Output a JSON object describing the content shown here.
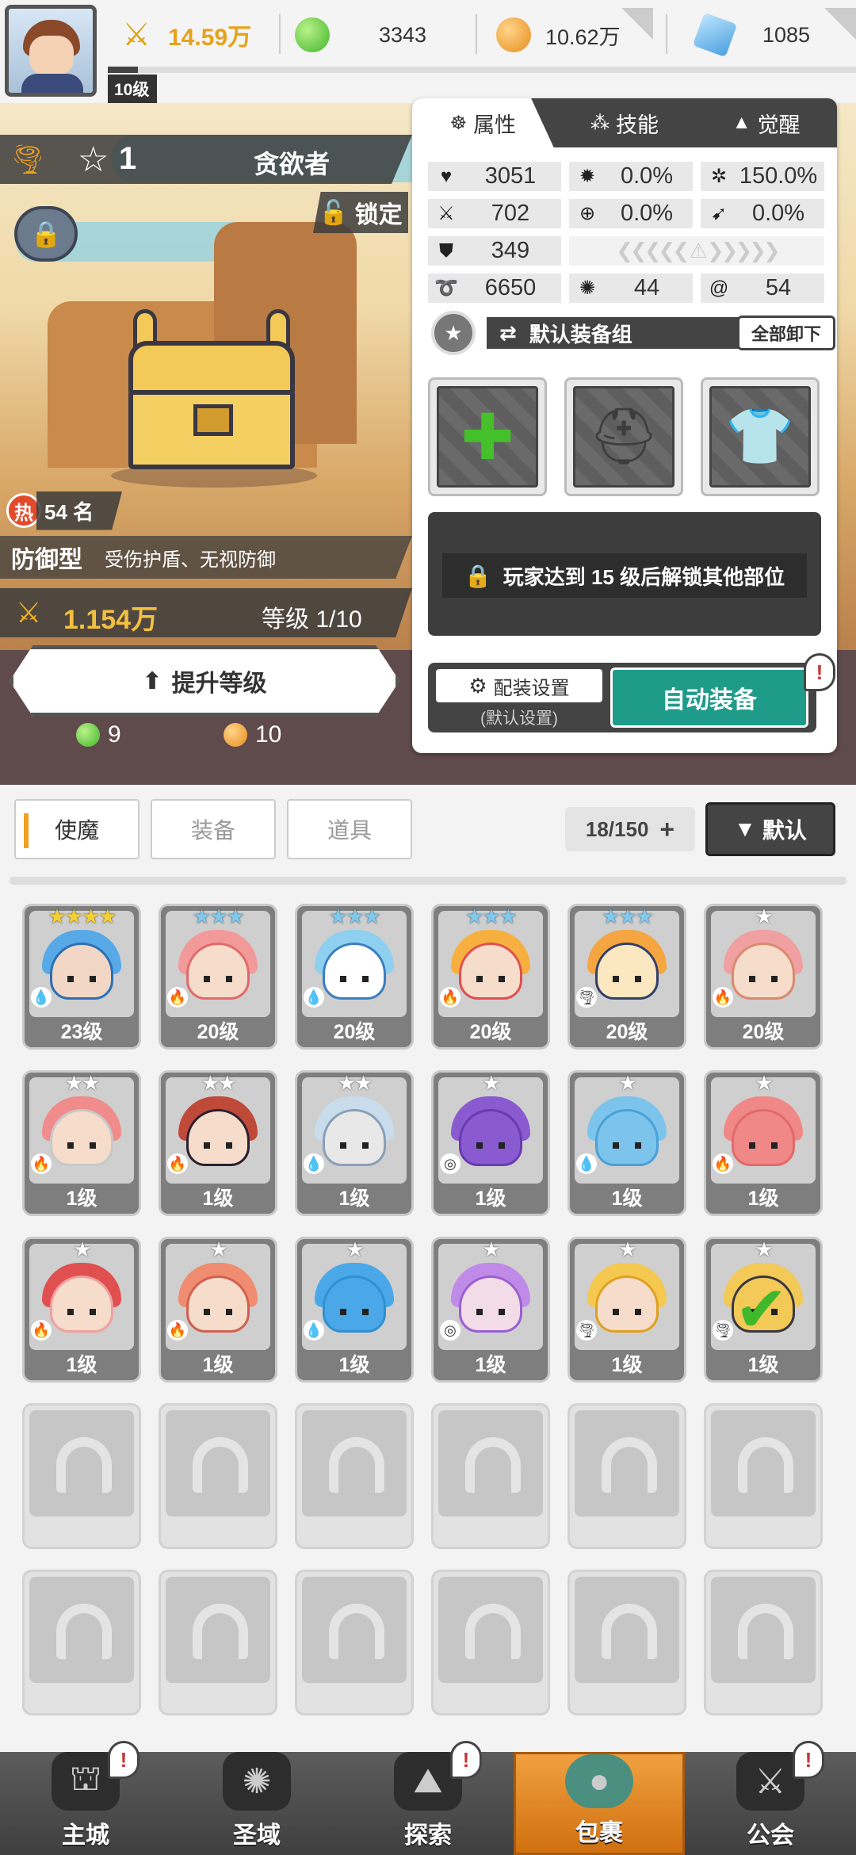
{
  "top_bar": {
    "power": "14.59万",
    "green_currency": "3343",
    "gold_currency": "10.62万",
    "gems": "1085",
    "level": "10级",
    "xp_fraction": 0.04
  },
  "hero": {
    "star_count": "1",
    "name": "贪欲者",
    "lock_label": "锁定",
    "rank": "54 名",
    "rank_badge": "热",
    "type": "防御型",
    "description": "受伤护盾、无视防御",
    "power": "1.154万",
    "level_text": "等级 1/10",
    "upgrade_label": "提升等级",
    "cost_green": "9",
    "cost_gold": "10"
  },
  "panel": {
    "tabs": [
      {
        "label": "属性",
        "icon": "mask-icon",
        "active": true
      },
      {
        "label": "技能",
        "icon": "sparkle-icon",
        "active": false
      },
      {
        "label": "觉醒",
        "icon": "triforce-icon",
        "active": false
      }
    ],
    "stats": {
      "hp": "3051",
      "crit": "0.0%",
      "crit_damage": "150.0%",
      "attack": "702",
      "accuracy": "0.0%",
      "dodge": "0.0%",
      "defense": "349",
      "speed": "6650",
      "stat_a": "44",
      "stat_b": "54"
    },
    "equip_group": "默认装备组",
    "unequip_all": "全部卸下",
    "locked_message": "玩家达到 15 级后解锁其他部位",
    "config_label": "配装设置",
    "config_sub": "(默认设置)",
    "auto_equip": "自动装备"
  },
  "inventory": {
    "tabs": [
      "使魔",
      "装备",
      "道具"
    ],
    "active_tab": "使魔",
    "count": "18/150",
    "sort_label": "默认",
    "cards": [
      {
        "level": "23级",
        "stars": "★★★★",
        "star_color": "#f5d030",
        "element": "water",
        "palette": [
          "#58a9e8",
          "#2e6fb4",
          "#f2d7c6"
        ]
      },
      {
        "level": "20级",
        "stars": "★★★",
        "star_color": "#7fc9ef",
        "element": "fire",
        "palette": [
          "#f29a9a",
          "#e06a6a",
          "#f6dccb"
        ]
      },
      {
        "level": "20级",
        "stars": "★★★",
        "star_color": "#7fc9ef",
        "element": "water",
        "palette": [
          "#8fd0f0",
          "#3a7fc0",
          "#ffffff"
        ]
      },
      {
        "level": "20级",
        "stars": "★★★",
        "star_color": "#7fc9ef",
        "element": "fire",
        "palette": [
          "#f7b040",
          "#e05050",
          "#f6dccb"
        ]
      },
      {
        "level": "20级",
        "stars": "★★★",
        "star_color": "#7fc9ef",
        "element": "wind",
        "palette": [
          "#f5a640",
          "#33406a",
          "#fbe7c0"
        ]
      },
      {
        "level": "20级",
        "stars": "★",
        "star_color": "#ffffff",
        "element": "fire",
        "palette": [
          "#f0a0a0",
          "#d88a70",
          "#f6dccb"
        ]
      },
      {
        "level": "1级",
        "stars": "★★",
        "star_color": "#ffffff",
        "element": "fire",
        "palette": [
          "#f08c8c",
          "#c8c8c8",
          "#f6dccb"
        ]
      },
      {
        "level": "1级",
        "stars": "★★",
        "star_color": "#ffffff",
        "element": "fire",
        "palette": [
          "#c04a3a",
          "#2c2030",
          "#f6dccb"
        ]
      },
      {
        "level": "1级",
        "stars": "★★",
        "star_color": "#ffffff",
        "element": "water",
        "palette": [
          "#c8dcec",
          "#8aa0b8",
          "#e8e8e8"
        ]
      },
      {
        "level": "1级",
        "stars": "★",
        "star_color": "#ffffff",
        "element": "arcane",
        "palette": [
          "#8a5ad0",
          "#6a3ab0",
          "#8a5ad0"
        ]
      },
      {
        "level": "1级",
        "stars": "★",
        "star_color": "#ffffff",
        "element": "water",
        "palette": [
          "#7cc4ec",
          "#4aa0d8",
          "#7cc4ec"
        ]
      },
      {
        "level": "1级",
        "stars": "★",
        "star_color": "#ffffff",
        "element": "fire",
        "palette": [
          "#f08888",
          "#e06a6a",
          "#f08888"
        ]
      },
      {
        "level": "1级",
        "stars": "★",
        "star_color": "#ffffff",
        "element": "fire",
        "palette": [
          "#e05050",
          "#f0a0a0",
          "#f6dccb"
        ]
      },
      {
        "level": "1级",
        "stars": "★",
        "star_color": "#ffffff",
        "element": "fire",
        "palette": [
          "#f08c70",
          "#d06050",
          "#f6dccb"
        ]
      },
      {
        "level": "1级",
        "stars": "★",
        "star_color": "#ffffff",
        "element": "water",
        "palette": [
          "#4aa8e8",
          "#3090d0",
          "#4aa8e8"
        ]
      },
      {
        "level": "1级",
        "stars": "★",
        "star_color": "#ffffff",
        "element": "arcane",
        "palette": [
          "#c08ae8",
          "#9a60d0",
          "#f2dce8"
        ]
      },
      {
        "level": "1级",
        "stars": "★",
        "star_color": "#ffffff",
        "element": "wind",
        "palette": [
          "#f5c850",
          "#e0a020",
          "#f6dccb"
        ]
      },
      {
        "level": "1级",
        "stars": "★",
        "star_color": "#ffffff",
        "element": "wind",
        "palette": [
          "#f3c957",
          "#3b3742",
          "#f3c957"
        ],
        "selected": true
      }
    ],
    "empty_slots": 12
  },
  "nav": [
    {
      "label": "主城",
      "icon": "castle-icon",
      "glyph": "⛫",
      "alert": true,
      "active": false
    },
    {
      "label": "圣域",
      "icon": "vortex-icon",
      "glyph": "✺",
      "alert": false,
      "active": false
    },
    {
      "label": "探索",
      "icon": "expedition-icon",
      "glyph": "⛰",
      "alert": true,
      "active": false
    },
    {
      "label": "包裹",
      "icon": "bag-icon",
      "glyph": "●",
      "alert": false,
      "active": true
    },
    {
      "label": "公会",
      "icon": "guild-icon",
      "glyph": "⚔",
      "alert": true,
      "active": false
    }
  ]
}
